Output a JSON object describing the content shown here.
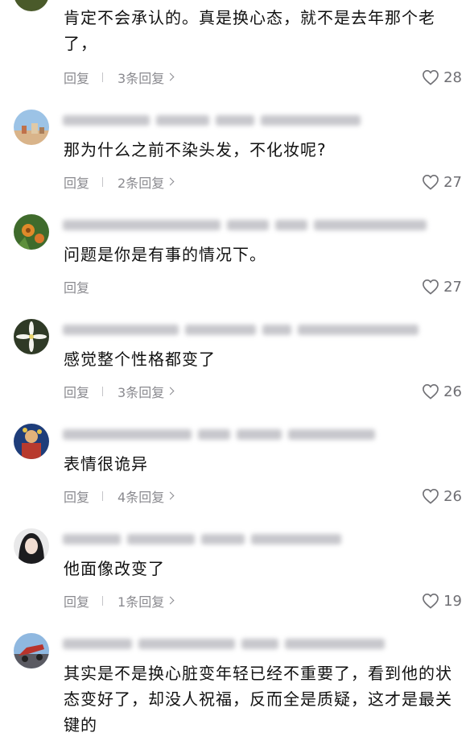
{
  "comments": [
    {
      "text": "肯定不会承认的。真是换心态，就不是去年那个老了，",
      "reply_label": "回复",
      "replies_label": "3条回复",
      "likes": "28"
    },
    {
      "text": "那为什么之前不染头发，不化妆呢?",
      "reply_label": "回复",
      "replies_label": "2条回复",
      "likes": "27"
    },
    {
      "text": "问题是你是有事的情况下。",
      "reply_label": "回复",
      "likes": "27"
    },
    {
      "text": "感觉整个性格都变了",
      "reply_label": "回复",
      "replies_label": "3条回复",
      "likes": "26"
    },
    {
      "text": "表情很诡异",
      "reply_label": "回复",
      "replies_label": "4条回复",
      "likes": "26"
    },
    {
      "text": "他面像改变了",
      "reply_label": "回复",
      "replies_label": "1条回复",
      "likes": "19"
    },
    {
      "text": "其实是不是换心脏变年轻已经不重要了，看到他的状态变好了，却没人祝福，反而全是质疑，这才是最关键的"
    }
  ],
  "icons": {
    "like": "heart-outline-icon",
    "expand": "chevron-right-icon"
  },
  "colors": {
    "text": "#111111",
    "meta": "#8a8a8f",
    "username_blur": "#c7c7cc"
  }
}
